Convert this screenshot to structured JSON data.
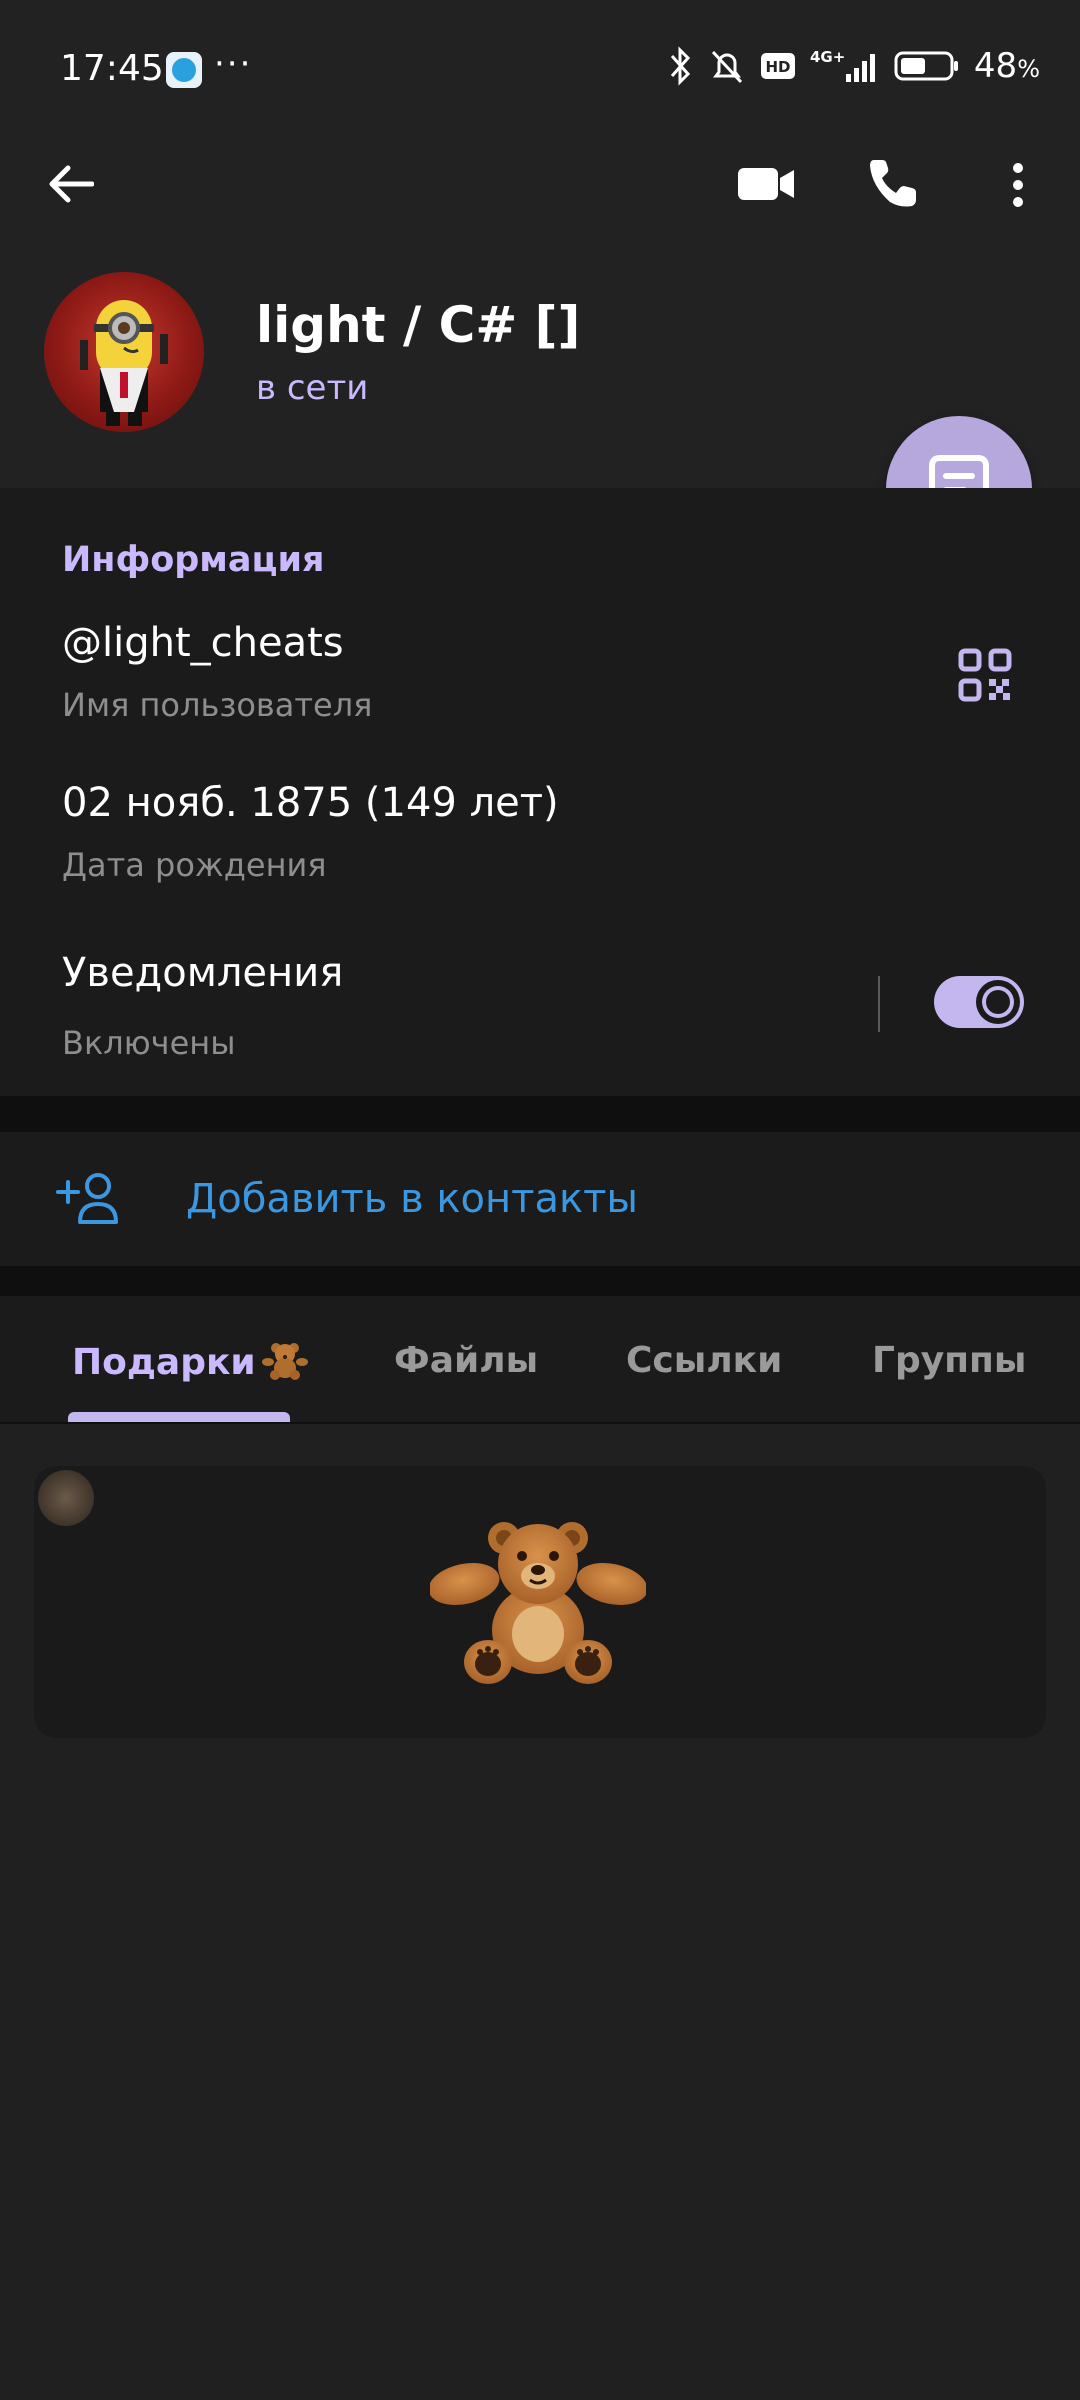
{
  "status_bar": {
    "time": "17:45",
    "dots": "···",
    "battery_percent": "48",
    "percent_sign": "%",
    "network": "4G+",
    "hd": "HD"
  },
  "profile": {
    "name": "light / C# []",
    "status": "в сети"
  },
  "info": {
    "title": "Информация",
    "username_value": "@light_cheats",
    "username_label": "Имя пользователя",
    "birthday_value": "02 нояб. 1875 (149 лет)",
    "birthday_label": "Дата рождения",
    "notifications_value": "Уведомления",
    "notifications_label": "Включены",
    "notifications_on": true
  },
  "actions": {
    "add_contact": "Добавить в контакты"
  },
  "tabs": [
    {
      "label": "Подарки",
      "active": true
    },
    {
      "label": "Файлы",
      "active": false
    },
    {
      "label": "Ссылки",
      "active": false
    },
    {
      "label": "Группы",
      "active": false
    }
  ],
  "colors": {
    "accent": "#cbb9ff",
    "link": "#3a97e0",
    "fab": "#b6a7dc"
  },
  "icons": [
    "back-arrow-icon",
    "video-call-icon",
    "phone-icon",
    "more-vert-icon",
    "qr-code-icon",
    "add-contact-icon",
    "message-icon",
    "teddy-bear-icon"
  ]
}
